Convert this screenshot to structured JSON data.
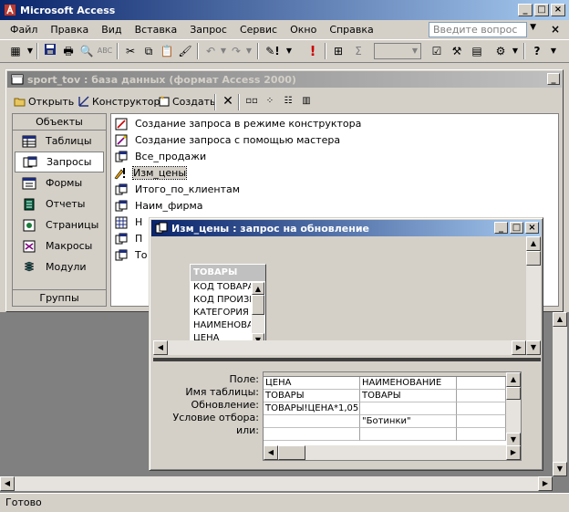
{
  "app": {
    "title": "Microsoft Access",
    "colors": {
      "titlebar": "#0a246a",
      "selection": "#d4d0c8"
    }
  },
  "menu": {
    "items": [
      "Файл",
      "Правка",
      "Вид",
      "Вставка",
      "Запрос",
      "Сервис",
      "Окно",
      "Справка"
    ],
    "help_placeholder": "Введите вопрос"
  },
  "toolbar": {
    "icons": [
      "view-icon",
      "save-icon",
      "print-icon",
      "print-preview-icon",
      "spellcheck-icon",
      "cut-icon",
      "copy-icon",
      "paste-icon",
      "format-painter-icon",
      "undo-icon",
      "redo-icon",
      "query-type-icon",
      "run-icon",
      "show-table-icon",
      "totals-icon",
      "top-values-icon",
      "properties-icon",
      "build-icon",
      "database-window-icon",
      "new-object-icon",
      "help-icon"
    ]
  },
  "db_window": {
    "title": "sport_tov : база данных (формат Access 2000)",
    "buttons": {
      "open": "Открыть",
      "design": "Конструктор",
      "create": "Создать"
    },
    "objects_header": "Объекты",
    "objects": [
      {
        "label": "Таблицы",
        "icon": "table-icon"
      },
      {
        "label": "Запросы",
        "icon": "query-icon"
      },
      {
        "label": "Формы",
        "icon": "form-icon"
      },
      {
        "label": "Отчеты",
        "icon": "report-icon"
      },
      {
        "label": "Страницы",
        "icon": "page-icon"
      },
      {
        "label": "Макросы",
        "icon": "macro-icon"
      },
      {
        "label": "Модули",
        "icon": "module-icon"
      }
    ],
    "groups_label": "Группы",
    "list": [
      "Создание запроса в режиме конструктора",
      "Создание запроса с помощью мастера",
      "Все_продажи",
      "Изм_цены",
      "Итого_по_клиентам",
      "Наим_фирма",
      "Н",
      "П",
      "То"
    ]
  },
  "query_window": {
    "title": "Изм_цены : запрос на обновление",
    "table": {
      "name": "ТОВАРЫ",
      "fields": [
        "КОД ТОВАРА",
        "КОД ПРОИЗВ",
        "КАТЕГОРИЯ",
        "НАИМЕНОВАН",
        "ЦЕНА"
      ]
    },
    "row_labels": [
      "Поле:",
      "Имя таблицы:",
      "Обновление:",
      "Условие отбора:",
      "или:"
    ],
    "columns": [
      [
        "ЦЕНА",
        "ТОВАРЫ",
        "ТОВАРЫ!ЦЕНА*1,05",
        "",
        ""
      ],
      [
        "НАИМЕНОВАНИЕ",
        "ТОВАРЫ",
        "",
        "\"Ботинки\"",
        ""
      ],
      [
        "",
        "",
        "",
        "",
        ""
      ]
    ]
  },
  "status": {
    "text": "Готово"
  }
}
